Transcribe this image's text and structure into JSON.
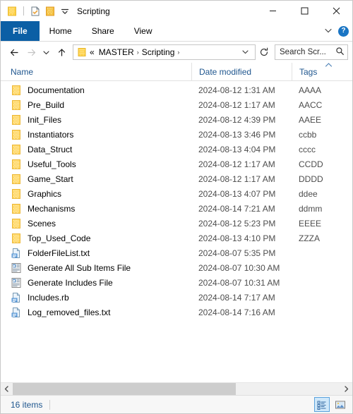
{
  "window": {
    "title": "Scripting",
    "quick_access": [
      {
        "name": "folder-icon",
        "label": "Folder"
      },
      {
        "name": "properties-icon",
        "label": "Properties"
      },
      {
        "name": "new-folder-icon",
        "label": "New folder"
      },
      {
        "name": "chevron-down-icon",
        "label": "Customize Quick Access Toolbar"
      }
    ],
    "controls": {
      "minimize": "—",
      "maximize": "□",
      "close": "✕"
    }
  },
  "ribbon": {
    "tabs": [
      {
        "label": "File",
        "active": true
      },
      {
        "label": "Home",
        "active": false
      },
      {
        "label": "Share",
        "active": false
      },
      {
        "label": "View",
        "active": false
      }
    ],
    "collapse_label": "⌄",
    "help_label": "?"
  },
  "navigation": {
    "back": "←",
    "forward": "→",
    "recent": "⌄",
    "up": "↑",
    "refresh": "↻",
    "dropdown": "⌄"
  },
  "address": {
    "prefix": "«",
    "crumbs": [
      "MASTER",
      "Scripting"
    ],
    "separator": "›"
  },
  "search": {
    "placeholder": "Search Scr...",
    "icon": "search-icon"
  },
  "columns": [
    {
      "key": "name",
      "label": "Name"
    },
    {
      "key": "date",
      "label": "Date modified"
    },
    {
      "key": "tags",
      "label": "Tags"
    }
  ],
  "sort": {
    "column": "Tags",
    "direction": "ascending",
    "indicator": "⌃"
  },
  "files": [
    {
      "name": "Documentation",
      "date": "2024-08-12 1:31 AM",
      "tags": "AAAA",
      "icon": "folder-icon"
    },
    {
      "name": "Pre_Build",
      "date": "2024-08-12 1:17 AM",
      "tags": "AACC",
      "icon": "folder-icon"
    },
    {
      "name": "Init_Files",
      "date": "2024-08-12 4:39 PM",
      "tags": "AAEE",
      "icon": "folder-icon"
    },
    {
      "name": "Instantiators",
      "date": "2024-08-13 3:46 PM",
      "tags": "ccbb",
      "icon": "folder-icon"
    },
    {
      "name": "Data_Struct",
      "date": "2024-08-13 4:04 PM",
      "tags": "cccc",
      "icon": "folder-icon"
    },
    {
      "name": "Useful_Tools",
      "date": "2024-08-12 1:17 AM",
      "tags": "CCDD",
      "icon": "folder-icon"
    },
    {
      "name": "Game_Start",
      "date": "2024-08-12 1:17 AM",
      "tags": "DDDD",
      "icon": "folder-icon"
    },
    {
      "name": "Graphics",
      "date": "2024-08-13 4:07 PM",
      "tags": "ddee",
      "icon": "folder-icon"
    },
    {
      "name": "Mechanisms",
      "date": "2024-08-14 7:21 AM",
      "tags": "ddmm",
      "icon": "folder-icon"
    },
    {
      "name": "Scenes",
      "date": "2024-08-12 5:23 PM",
      "tags": "EEEE",
      "icon": "folder-icon"
    },
    {
      "name": "Top_Used_Code",
      "date": "2024-08-13 4:10 PM",
      "tags": "ZZZA",
      "icon": "folder-icon"
    },
    {
      "name": "FolderFileList.txt",
      "date": "2024-08-07 5:35 PM",
      "tags": "",
      "icon": "text-file-icon"
    },
    {
      "name": "Generate All Sub Items File",
      "date": "2024-08-07 10:30 AM",
      "tags": "",
      "icon": "script-file-icon"
    },
    {
      "name": "Generate Includes File",
      "date": "2024-08-07 10:31 AM",
      "tags": "",
      "icon": "script-file-icon"
    },
    {
      "name": "Includes.rb",
      "date": "2024-08-14 7:17 AM",
      "tags": "",
      "icon": "text-file-icon"
    },
    {
      "name": "Log_removed_files.txt",
      "date": "2024-08-14 7:16 AM",
      "tags": "",
      "icon": "text-file-icon"
    }
  ],
  "scrollbar": {
    "left_arrow": "‹",
    "right_arrow": "›"
  },
  "status": {
    "item_count": "16 items",
    "views": [
      {
        "name": "details-view-button",
        "label": "Details view",
        "active": true
      },
      {
        "name": "large-icons-view-button",
        "label": "Large icons view",
        "active": false
      }
    ]
  },
  "colors": {
    "accent": "#0b5fa5",
    "header_text": "#20578f",
    "folder": "#ffd966",
    "help": "#1a75c4"
  }
}
